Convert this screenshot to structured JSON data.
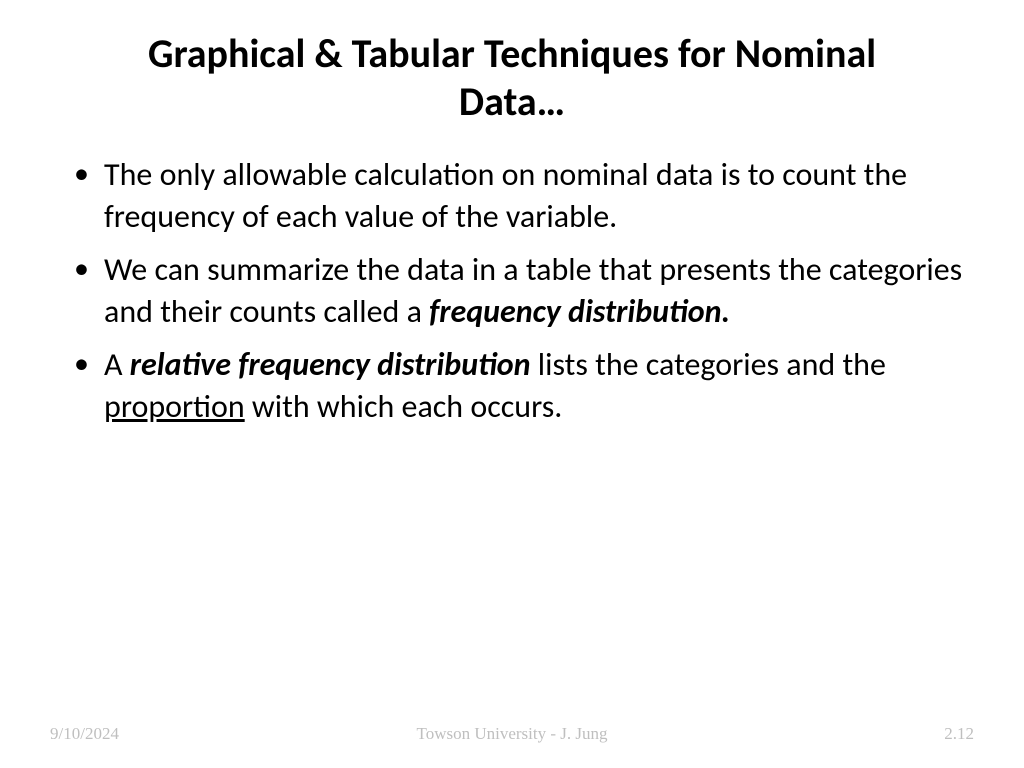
{
  "title": "Graphical & Tabular Techniques for Nominal Data…",
  "bullets": {
    "b1": "The only allowable calculation on nominal data is to count the frequency of each value of the variable.",
    "b2_pre": "We can summarize the data in a table that presents the categories and their counts called a ",
    "b2_bold": "frequency distribution.",
    "b3_pre": "A ",
    "b3_bold": "relative frequency distribution",
    "b3_mid": " lists the categories and the ",
    "b3_underline": "proportion",
    "b3_post": " with which each occurs."
  },
  "footer": {
    "date": "9/10/2024",
    "center": "Towson University - J. Jung",
    "page": "2.12"
  }
}
